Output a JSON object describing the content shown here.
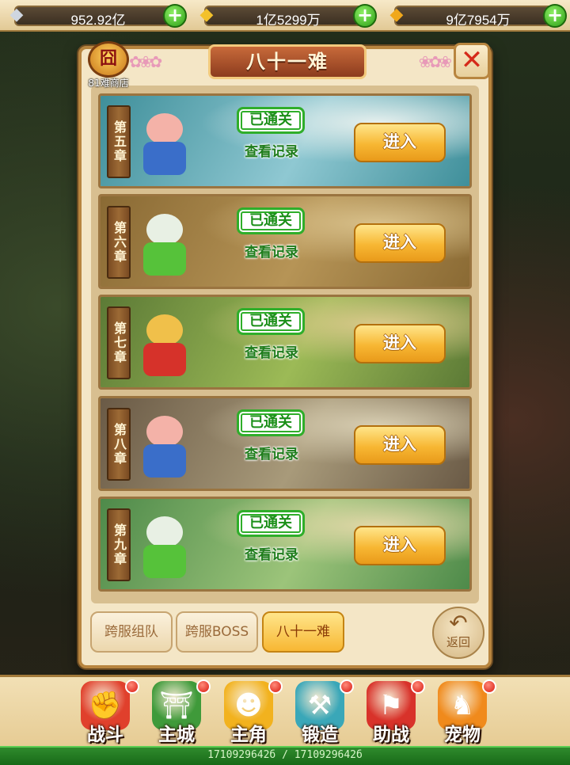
{
  "currencies": [
    {
      "icon": "silver-ingot-icon",
      "value": "952.92亿"
    },
    {
      "icon": "gold-ingot-icon",
      "value": "1亿5299万"
    },
    {
      "icon": "bound-gold-icon",
      "value": "9亿7954万"
    }
  ],
  "panel": {
    "title": "八十一难",
    "shop_label": "81难商店",
    "shop_icon_text": "囧",
    "close_symbol": "✕"
  },
  "chapters": [
    {
      "name": "第五章",
      "status": "已通关",
      "record": "查看记录",
      "enter": "进入",
      "scene": [
        "#3f8f9a",
        "#8fc8d2",
        "#e7f0ee"
      ],
      "hero": {
        "face": "#f4b2a8",
        "body": "#3a6ec9"
      }
    },
    {
      "name": "第六章",
      "status": "已通关",
      "record": "查看记录",
      "enter": "进入",
      "scene": [
        "#8a6a34",
        "#b69456",
        "#d8c08a"
      ],
      "hero": {
        "face": "#e8f0e4",
        "body": "#56c23a"
      }
    },
    {
      "name": "第七章",
      "status": "已通关",
      "record": "查看记录",
      "enter": "进入",
      "scene": [
        "#5c7a36",
        "#9cba56",
        "#d9c98a"
      ],
      "hero": {
        "face": "#f0c04a",
        "body": "#d6322a"
      }
    },
    {
      "name": "第八章",
      "status": "已通关",
      "record": "查看记录",
      "enter": "进入",
      "scene": [
        "#6a5a46",
        "#a89a7a",
        "#d8ceb2"
      ],
      "hero": {
        "face": "#f4b2a8",
        "body": "#3a6ec9"
      }
    },
    {
      "name": "第九章",
      "status": "已通关",
      "record": "查看记录",
      "enter": "进入",
      "scene": [
        "#4e8a4a",
        "#9cc47a",
        "#e2d8a8"
      ],
      "hero": {
        "face": "#e8f0e4",
        "body": "#56c23a"
      }
    }
  ],
  "tabs": [
    {
      "label": "跨服组队",
      "active": false
    },
    {
      "label": "跨服BOSS",
      "active": false
    },
    {
      "label": "八十一难",
      "active": true
    }
  ],
  "back": {
    "label": "返回",
    "arrow": "↶"
  },
  "nav": [
    {
      "label": "战斗",
      "icon": "battle-icon",
      "glyph": "✊",
      "color": "#e0402c",
      "dot": true
    },
    {
      "label": "主城",
      "icon": "city-icon",
      "glyph": "⛩",
      "color": "#3f9a3a",
      "dot": true
    },
    {
      "label": "主角",
      "icon": "hero-icon",
      "glyph": "☻",
      "color": "#f2b21e",
      "dot": true
    },
    {
      "label": "锻造",
      "icon": "forge-icon",
      "glyph": "⚒",
      "color": "#3aa7b8",
      "dot": true
    },
    {
      "label": "助战",
      "icon": "assist-icon",
      "glyph": "⚑",
      "color": "#d8322a",
      "dot": true
    },
    {
      "label": "宠物",
      "icon": "pet-icon",
      "glyph": "♞",
      "color": "#f08a1c",
      "dot": true
    }
  ],
  "status_text": "1710929642б / 1710929642б",
  "colors": {
    "accent_green": "#2fae2a",
    "button_gold": "#f7b733",
    "panel_bg": "#f4e6c6"
  }
}
